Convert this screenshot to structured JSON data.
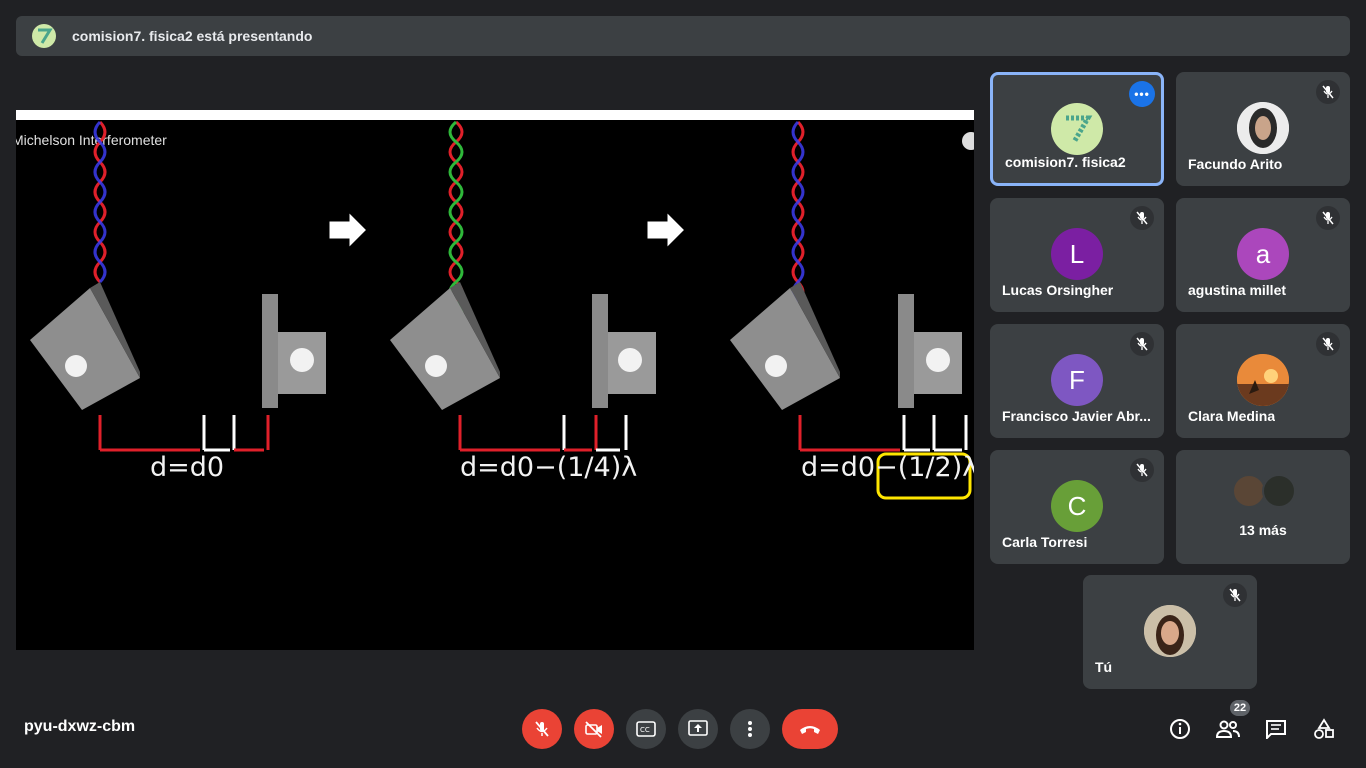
{
  "banner": {
    "presenting_text": "comision7. fisica2 está presentando"
  },
  "presentation": {
    "video_title": "Michelson Interferometer",
    "labels": [
      "d=d0",
      "d=d0−(1/4)λ",
      "d=d0−(1/2)λ"
    ]
  },
  "participants": [
    {
      "name": "comision7. fisica2",
      "avatar": "logo",
      "color": "#cfe9a8",
      "muted": false,
      "active": true
    },
    {
      "name": "Facundo Arito",
      "avatar": "photo",
      "color": "#d8d8d8",
      "muted": true
    },
    {
      "name": "Lucas Orsingher",
      "avatar": "L",
      "color": "#7b1fa2",
      "muted": true
    },
    {
      "name": "agustina millet",
      "avatar": "a",
      "color": "#ab47bc",
      "muted": true
    },
    {
      "name": "Francisco Javier Abr...",
      "avatar": "F",
      "color": "#7e57c2",
      "muted": true
    },
    {
      "name": "Clara Medina",
      "avatar": "photo",
      "color": "#e07a2f",
      "muted": true
    },
    {
      "name": "Carla Torresi",
      "avatar": "C",
      "color": "#689f38",
      "muted": true
    }
  ],
  "more_tile": {
    "label": "13 más"
  },
  "self_tile": {
    "name": "Tú",
    "muted": true
  },
  "footer": {
    "meeting_code": "pyu-dxwz-cbm",
    "participants_count": "22"
  }
}
